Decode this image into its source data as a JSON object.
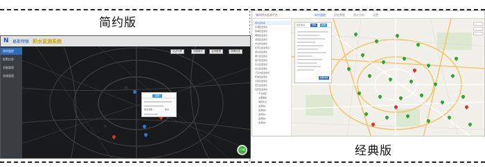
{
  "variants": {
    "simple_label": "简约版",
    "classic_label": "经典版"
  },
  "simple": {
    "theme": "dark",
    "app_title": "积水监测系统",
    "company_name": "易斯特联",
    "logo_mark": "N",
    "sidebar_items": [
      "实时监控",
      "报警信息",
      "设备管理",
      "系统管理"
    ],
    "toolbar_buttons": [
      "站点列表",
      "地图模式",
      "监测数据",
      "报警信息"
    ],
    "popup": {
      "tag": "监测",
      "label_left": "积水深度",
      "label_right": "积水"
    },
    "zoom_badge": "12级"
  },
  "classic": {
    "theme": "light",
    "brand": "城市积水监测平台",
    "tabs": [
      "实时监控",
      "历史数据",
      "统计分析",
      "设置"
    ],
    "active_tab_index": 0,
    "sidebar_items": [
      "积水点列表",
      "东城区监测点",
      "西城区监测点",
      "朝阳区监测点",
      "海淀区监测点",
      "丰台区监测点",
      "石景山区监测点",
      "通州区监测点",
      "顺义区监测点",
      "昌平区监测点",
      "大兴区监测点",
      "房山区监测点",
      "门头沟区监测点",
      "怀柔区监测点",
      "平谷区监测点",
      "密云区监测点",
      "延庆区监测点",
      "下凹桥区",
      "主要路段",
      "易积水点",
      "监测站1",
      "监测站2",
      "监测站3",
      "监测站4",
      "监测站5"
    ],
    "panel": {
      "title": "站点信息",
      "button_primary": "详情",
      "button_secondary": "关闭",
      "action": "查看详情"
    }
  },
  "colors": {
    "accent": "#2a6ebc",
    "alarm": "#e0302c",
    "normal": "#2ea52e",
    "dark_bg": "#191a1b"
  }
}
